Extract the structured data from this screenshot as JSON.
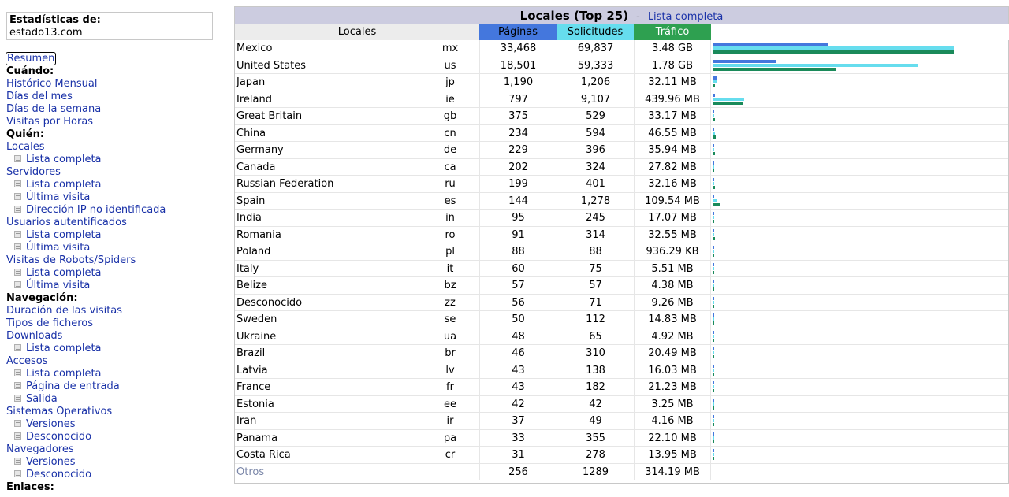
{
  "sidebar": {
    "stats_title": "Estadísticas de:",
    "stats_domain": "estado13.com",
    "items": [
      {
        "label": "Resumen",
        "type": "link",
        "active": true
      },
      {
        "label": "Cuándo:",
        "type": "section"
      },
      {
        "label": "Histórico Mensual",
        "type": "link"
      },
      {
        "label": "Días del mes",
        "type": "link"
      },
      {
        "label": "Días de la semana",
        "type": "link"
      },
      {
        "label": "Visitas por Horas",
        "type": "link"
      },
      {
        "label": "Quién:",
        "type": "section"
      },
      {
        "label": "Locales",
        "type": "link"
      },
      {
        "label": "Lista completa",
        "type": "sub"
      },
      {
        "label": "Servidores",
        "type": "link"
      },
      {
        "label": "Lista completa",
        "type": "sub"
      },
      {
        "label": "Última visita",
        "type": "sub"
      },
      {
        "label": "Dirección IP no identificada",
        "type": "sub"
      },
      {
        "label": "Usuarios autentificados",
        "type": "link"
      },
      {
        "label": "Lista completa",
        "type": "sub"
      },
      {
        "label": "Última visita",
        "type": "sub"
      },
      {
        "label": "Visitas de Robots/Spiders",
        "type": "link"
      },
      {
        "label": "Lista completa",
        "type": "sub"
      },
      {
        "label": "Última visita",
        "type": "sub"
      },
      {
        "label": "Navegación:",
        "type": "section"
      },
      {
        "label": "Duración de las visitas",
        "type": "link"
      },
      {
        "label": "Tipos de ficheros",
        "type": "link"
      },
      {
        "label": "Downloads",
        "type": "link"
      },
      {
        "label": "Lista completa",
        "type": "sub"
      },
      {
        "label": "Accesos",
        "type": "link"
      },
      {
        "label": "Lista completa",
        "type": "sub"
      },
      {
        "label": "Página de entrada",
        "type": "sub"
      },
      {
        "label": "Salida",
        "type": "sub"
      },
      {
        "label": "Sistemas Operativos",
        "type": "link"
      },
      {
        "label": "Versiones",
        "type": "sub"
      },
      {
        "label": "Desconocido",
        "type": "sub"
      },
      {
        "label": "Navegadores",
        "type": "link"
      },
      {
        "label": "Versiones",
        "type": "sub"
      },
      {
        "label": "Desconocido",
        "type": "sub"
      },
      {
        "label": "Enlaces:",
        "type": "section"
      }
    ]
  },
  "table": {
    "title": "Locales (Top 25)",
    "separator": "-",
    "full_list_link": "Lista completa",
    "headers": {
      "locales": "Locales",
      "paginas": "Páginas",
      "solicitudes": "Solicitudes",
      "trafico": "Tráfico"
    },
    "colors": {
      "title_bg": "#cccce0",
      "paginas": "#4477dd",
      "solicitudes": "#66ddee",
      "trafico": "#2ea050",
      "trafico_bar": "#1a8a5a"
    },
    "rows": [
      {
        "name": "Mexico",
        "code": "mx",
        "pages": "33,468",
        "hits": "69,837",
        "bandwidth": "3.48 GB",
        "bar": {
          "pages": 0.48,
          "hits": 1.0,
          "bandwidth": 1.0
        }
      },
      {
        "name": "United States",
        "code": "us",
        "pages": "18,501",
        "hits": "59,333",
        "bandwidth": "1.78 GB",
        "bar": {
          "pages": 0.265,
          "hits": 0.85,
          "bandwidth": 0.51
        }
      },
      {
        "name": "Japan",
        "code": "jp",
        "pages": "1,190",
        "hits": "1,206",
        "bandwidth": "32.11 MB",
        "bar": {
          "pages": 0.017,
          "hits": 0.017,
          "bandwidth": 0.009
        }
      },
      {
        "name": "Ireland",
        "code": "ie",
        "pages": "797",
        "hits": "9,107",
        "bandwidth": "439.96 MB",
        "bar": {
          "pages": 0.011,
          "hits": 0.13,
          "bandwidth": 0.126
        }
      },
      {
        "name": "Great Britain",
        "code": "gb",
        "pages": "375",
        "hits": "529",
        "bandwidth": "33.17 MB",
        "bar": {
          "pages": 0.005,
          "hits": 0.008,
          "bandwidth": 0.01
        }
      },
      {
        "name": "China",
        "code": "cn",
        "pages": "234",
        "hits": "594",
        "bandwidth": "46.55 MB",
        "bar": {
          "pages": 0.004,
          "hits": 0.009,
          "bandwidth": 0.013
        }
      },
      {
        "name": "Germany",
        "code": "de",
        "pages": "229",
        "hits": "396",
        "bandwidth": "35.94 MB",
        "bar": {
          "pages": 0.004,
          "hits": 0.006,
          "bandwidth": 0.01
        }
      },
      {
        "name": "Canada",
        "code": "ca",
        "pages": "202",
        "hits": "324",
        "bandwidth": "27.82 MB",
        "bar": {
          "pages": 0.003,
          "hits": 0.005,
          "bandwidth": 0.008
        }
      },
      {
        "name": "Russian Federation",
        "code": "ru",
        "pages": "199",
        "hits": "401",
        "bandwidth": "32.16 MB",
        "bar": {
          "pages": 0.003,
          "hits": 0.006,
          "bandwidth": 0.009
        }
      },
      {
        "name": "Spain",
        "code": "es",
        "pages": "144",
        "hits": "1,278",
        "bandwidth": "109.54 MB",
        "bar": {
          "pages": 0.002,
          "hits": 0.018,
          "bandwidth": 0.031
        }
      },
      {
        "name": "India",
        "code": "in",
        "pages": "95",
        "hits": "245",
        "bandwidth": "17.07 MB",
        "bar": {
          "pages": 0.002,
          "hits": 0.004,
          "bandwidth": 0.005
        }
      },
      {
        "name": "Romania",
        "code": "ro",
        "pages": "91",
        "hits": "314",
        "bandwidth": "32.55 MB",
        "bar": {
          "pages": 0.002,
          "hits": 0.004,
          "bandwidth": 0.009
        }
      },
      {
        "name": "Poland",
        "code": "pl",
        "pages": "88",
        "hits": "88",
        "bandwidth": "936.29 KB",
        "bar": {
          "pages": 0.002,
          "hits": 0.002,
          "bandwidth": 0.002
        }
      },
      {
        "name": "Italy",
        "code": "it",
        "pages": "60",
        "hits": "75",
        "bandwidth": "5.51 MB",
        "bar": {
          "pages": 0.002,
          "hits": 0.002,
          "bandwidth": 0.002
        }
      },
      {
        "name": "Belize",
        "code": "bz",
        "pages": "57",
        "hits": "57",
        "bandwidth": "4.38 MB",
        "bar": {
          "pages": 0.002,
          "hits": 0.002,
          "bandwidth": 0.002
        }
      },
      {
        "name": "Desconocido",
        "code": "zz",
        "pages": "56",
        "hits": "71",
        "bandwidth": "9.26 MB",
        "bar": {
          "pages": 0.002,
          "hits": 0.002,
          "bandwidth": 0.003
        }
      },
      {
        "name": "Sweden",
        "code": "se",
        "pages": "50",
        "hits": "112",
        "bandwidth": "14.83 MB",
        "bar": {
          "pages": 0.002,
          "hits": 0.002,
          "bandwidth": 0.004
        }
      },
      {
        "name": "Ukraine",
        "code": "ua",
        "pages": "48",
        "hits": "65",
        "bandwidth": "4.92 MB",
        "bar": {
          "pages": 0.002,
          "hits": 0.002,
          "bandwidth": 0.002
        }
      },
      {
        "name": "Brazil",
        "code": "br",
        "pages": "46",
        "hits": "310",
        "bandwidth": "20.49 MB",
        "bar": {
          "pages": 0.002,
          "hits": 0.004,
          "bandwidth": 0.006
        }
      },
      {
        "name": "Latvia",
        "code": "lv",
        "pages": "43",
        "hits": "138",
        "bandwidth": "16.03 MB",
        "bar": {
          "pages": 0.002,
          "hits": 0.002,
          "bandwidth": 0.005
        }
      },
      {
        "name": "France",
        "code": "fr",
        "pages": "43",
        "hits": "182",
        "bandwidth": "21.23 MB",
        "bar": {
          "pages": 0.002,
          "hits": 0.003,
          "bandwidth": 0.006
        }
      },
      {
        "name": "Estonia",
        "code": "ee",
        "pages": "42",
        "hits": "42",
        "bandwidth": "3.25 MB",
        "bar": {
          "pages": 0.002,
          "hits": 0.002,
          "bandwidth": 0.002
        }
      },
      {
        "name": "Iran",
        "code": "ir",
        "pages": "37",
        "hits": "49",
        "bandwidth": "4.16 MB",
        "bar": {
          "pages": 0.002,
          "hits": 0.002,
          "bandwidth": 0.002
        }
      },
      {
        "name": "Panama",
        "code": "pa",
        "pages": "33",
        "hits": "355",
        "bandwidth": "22.10 MB",
        "bar": {
          "pages": 0.002,
          "hits": 0.005,
          "bandwidth": 0.006
        }
      },
      {
        "name": "Costa Rica",
        "code": "cr",
        "pages": "31",
        "hits": "278",
        "bandwidth": "13.95 MB",
        "bar": {
          "pages": 0.002,
          "hits": 0.004,
          "bandwidth": 0.004
        }
      }
    ],
    "otros": {
      "name": "Otros",
      "pages": "256",
      "hits": "1289",
      "bandwidth": "314.19 MB"
    }
  }
}
